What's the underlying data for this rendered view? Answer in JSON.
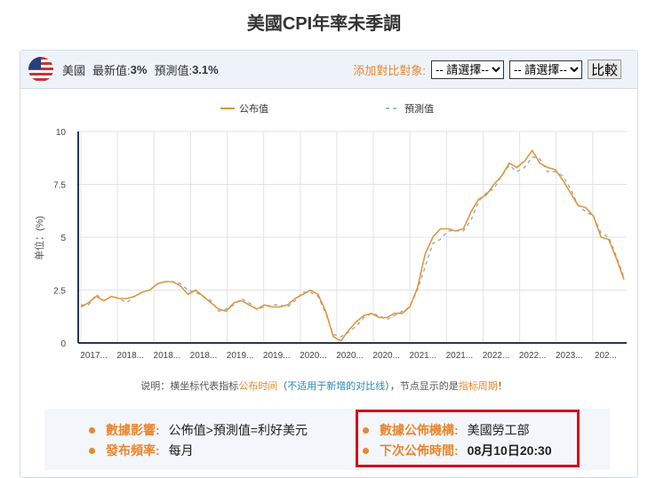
{
  "title": "美國CPI年率未季調",
  "topbar": {
    "country": "美國",
    "latest_label": "最新值:",
    "latest_value": "3%",
    "forecast_label": "預測值:",
    "forecast_value": "3.1%",
    "add_compare": "添加對比對象:",
    "select1": "-- 請選擇--",
    "select2": "-- 請選擇--",
    "compare_button": "比較"
  },
  "note": {
    "p1": "说明：横坐标代表指标",
    "p2": "公布时间",
    "p3": "（",
    "p4": "不适用于新增的对比线",
    "p5": "），节点显示的是",
    "p6": "指标周期",
    "p7": "！"
  },
  "info": {
    "impact_label": "數據影響:",
    "impact_value": "公佈值>預測值=利好美元",
    "freq_label": "發布頻率:",
    "freq_value": "每月",
    "org_label": "數據公佈機構:",
    "org_value": "美國勞工部",
    "next_label": "下次公佈時間:",
    "next_value": "08月10日20:30"
  },
  "colors": {
    "actual": "#e0973a",
    "forecast": "#8fa9bd"
  },
  "chart_data": {
    "type": "line",
    "ylabel": "单位：(%)",
    "ylim": [
      0,
      10
    ],
    "yticks": [
      "0",
      "2.5",
      "5",
      "7.5",
      "10"
    ],
    "xticks": [
      "2017...",
      "2018...",
      "2018...",
      "2018...",
      "2019...",
      "2019...",
      "2020...",
      "2020...",
      "2020...",
      "2021...",
      "2021...",
      "2022...",
      "2022...",
      "2023...",
      "202..."
    ],
    "series": [
      {
        "name": "公布值",
        "values": [
          1.7,
          1.9,
          2.2,
          2.0,
          2.2,
          2.1,
          2.1,
          2.2,
          2.4,
          2.5,
          2.8,
          2.9,
          2.9,
          2.7,
          2.3,
          2.5,
          2.2,
          1.9,
          1.6,
          1.5,
          1.9,
          2.0,
          1.8,
          1.6,
          1.8,
          1.7,
          1.7,
          1.8,
          2.1,
          2.3,
          2.5,
          2.3,
          1.5,
          0.3,
          0.1,
          0.6,
          1.0,
          1.3,
          1.4,
          1.2,
          1.2,
          1.4,
          1.4,
          1.7,
          2.6,
          4.2,
          5.0,
          5.4,
          5.4,
          5.3,
          5.4,
          6.2,
          6.8,
          7.0,
          7.5,
          7.9,
          8.5,
          8.3,
          8.6,
          9.1,
          8.5,
          8.3,
          8.2,
          7.7,
          7.1,
          6.5,
          6.4,
          6.0,
          5.0,
          4.9,
          4.0,
          3.0
        ]
      },
      {
        "name": "預測值",
        "values": [
          1.8,
          1.8,
          2.3,
          2.0,
          2.2,
          2.1,
          1.9,
          2.2,
          2.4,
          2.5,
          2.8,
          2.9,
          2.9,
          2.8,
          2.5,
          2.4,
          2.2,
          2.0,
          1.5,
          1.6,
          1.8,
          2.1,
          1.9,
          1.6,
          1.7,
          1.8,
          1.8,
          1.7,
          2.0,
          2.4,
          2.4,
          2.2,
          1.4,
          0.4,
          0.3,
          0.5,
          0.8,
          1.2,
          1.4,
          1.3,
          1.1,
          1.3,
          1.5,
          1.7,
          2.5,
          3.6,
          4.7,
          4.9,
          5.3,
          5.3,
          5.3,
          5.8,
          6.7,
          7.1,
          7.3,
          7.9,
          8.4,
          8.1,
          8.3,
          8.8,
          8.7,
          8.1,
          8.1,
          7.9,
          7.3,
          6.5,
          6.2,
          6.0,
          5.2,
          5.0,
          4.1,
          3.1
        ]
      }
    ]
  }
}
